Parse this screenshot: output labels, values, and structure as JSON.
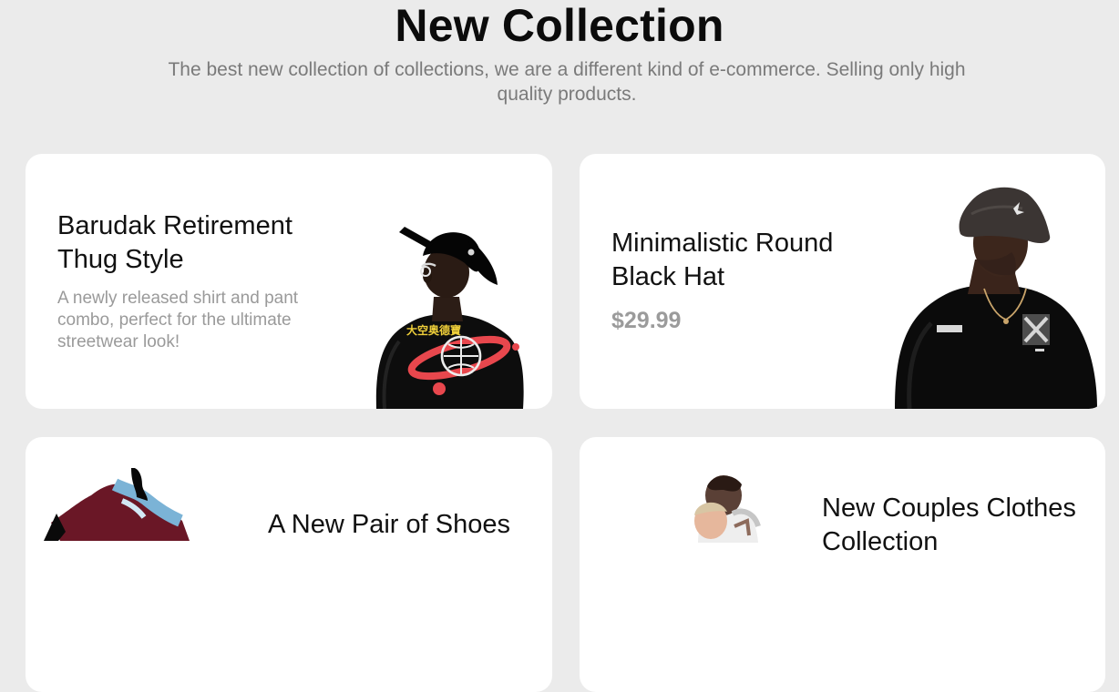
{
  "header": {
    "title": "New Collection",
    "subtitle": "The best new collection of collections, we are a different kind of e-commerce. Selling only high quality products."
  },
  "products": [
    {
      "title": "Barudak Retirement Thug Style",
      "description": "A newly released shirt and pant combo, perfect for the ultimate streetwear look!",
      "image": "man-in-black-cap-and-graphic-sweatshirt"
    },
    {
      "title": "Minimalistic Round Black Hat",
      "price": "$29.99",
      "image": "man-in-bucket-hat-and-black-tee"
    },
    {
      "title": "A New Pair of Shoes",
      "image": "sneaker"
    },
    {
      "title": "New Couples Clothes Collection",
      "image": "couple-photo"
    }
  ],
  "colors": {
    "page_background": "#ebebeb",
    "card_background": "#ffffff",
    "title_text": "#111111",
    "muted_text": "#9a9a9a"
  }
}
